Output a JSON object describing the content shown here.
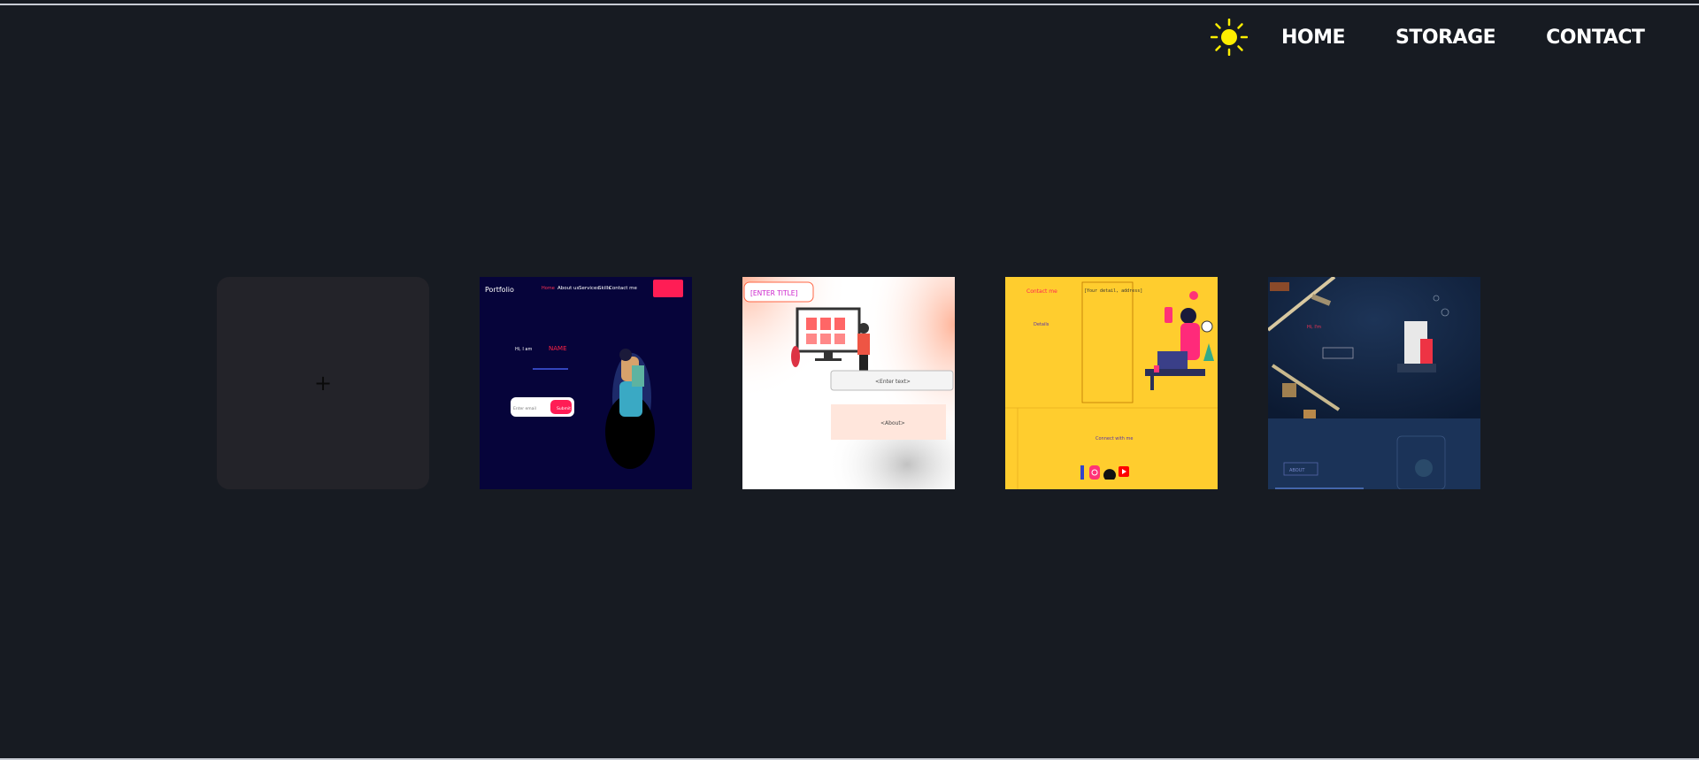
{
  "nav": {
    "theme_toggle_icon": "sun-icon",
    "sun_color": "#ffee00",
    "links": [
      "HOME",
      "STORAGE",
      "CONTACT"
    ]
  },
  "cards": {
    "add_label": "+",
    "templates": [
      {
        "bg": "#06043a",
        "texts": [
          "Portfolio",
          "Home",
          "About us",
          "Services",
          "Skills",
          "Contact me",
          "Hi, I am",
          "NAME",
          "Enter email",
          "Submit"
        ]
      },
      {
        "bg": "#ffffff",
        "texts": [
          "[ENTER TITLE]",
          "<Enter text>",
          "<About>"
        ]
      },
      {
        "bg": "#ffcd2e",
        "texts": [
          "Contact me",
          "[Your detail, address]",
          "Details",
          "Connect with me"
        ]
      },
      {
        "bg": "#10223e",
        "texts": [
          "Hi, I'm",
          "ABOUT"
        ]
      }
    ]
  }
}
